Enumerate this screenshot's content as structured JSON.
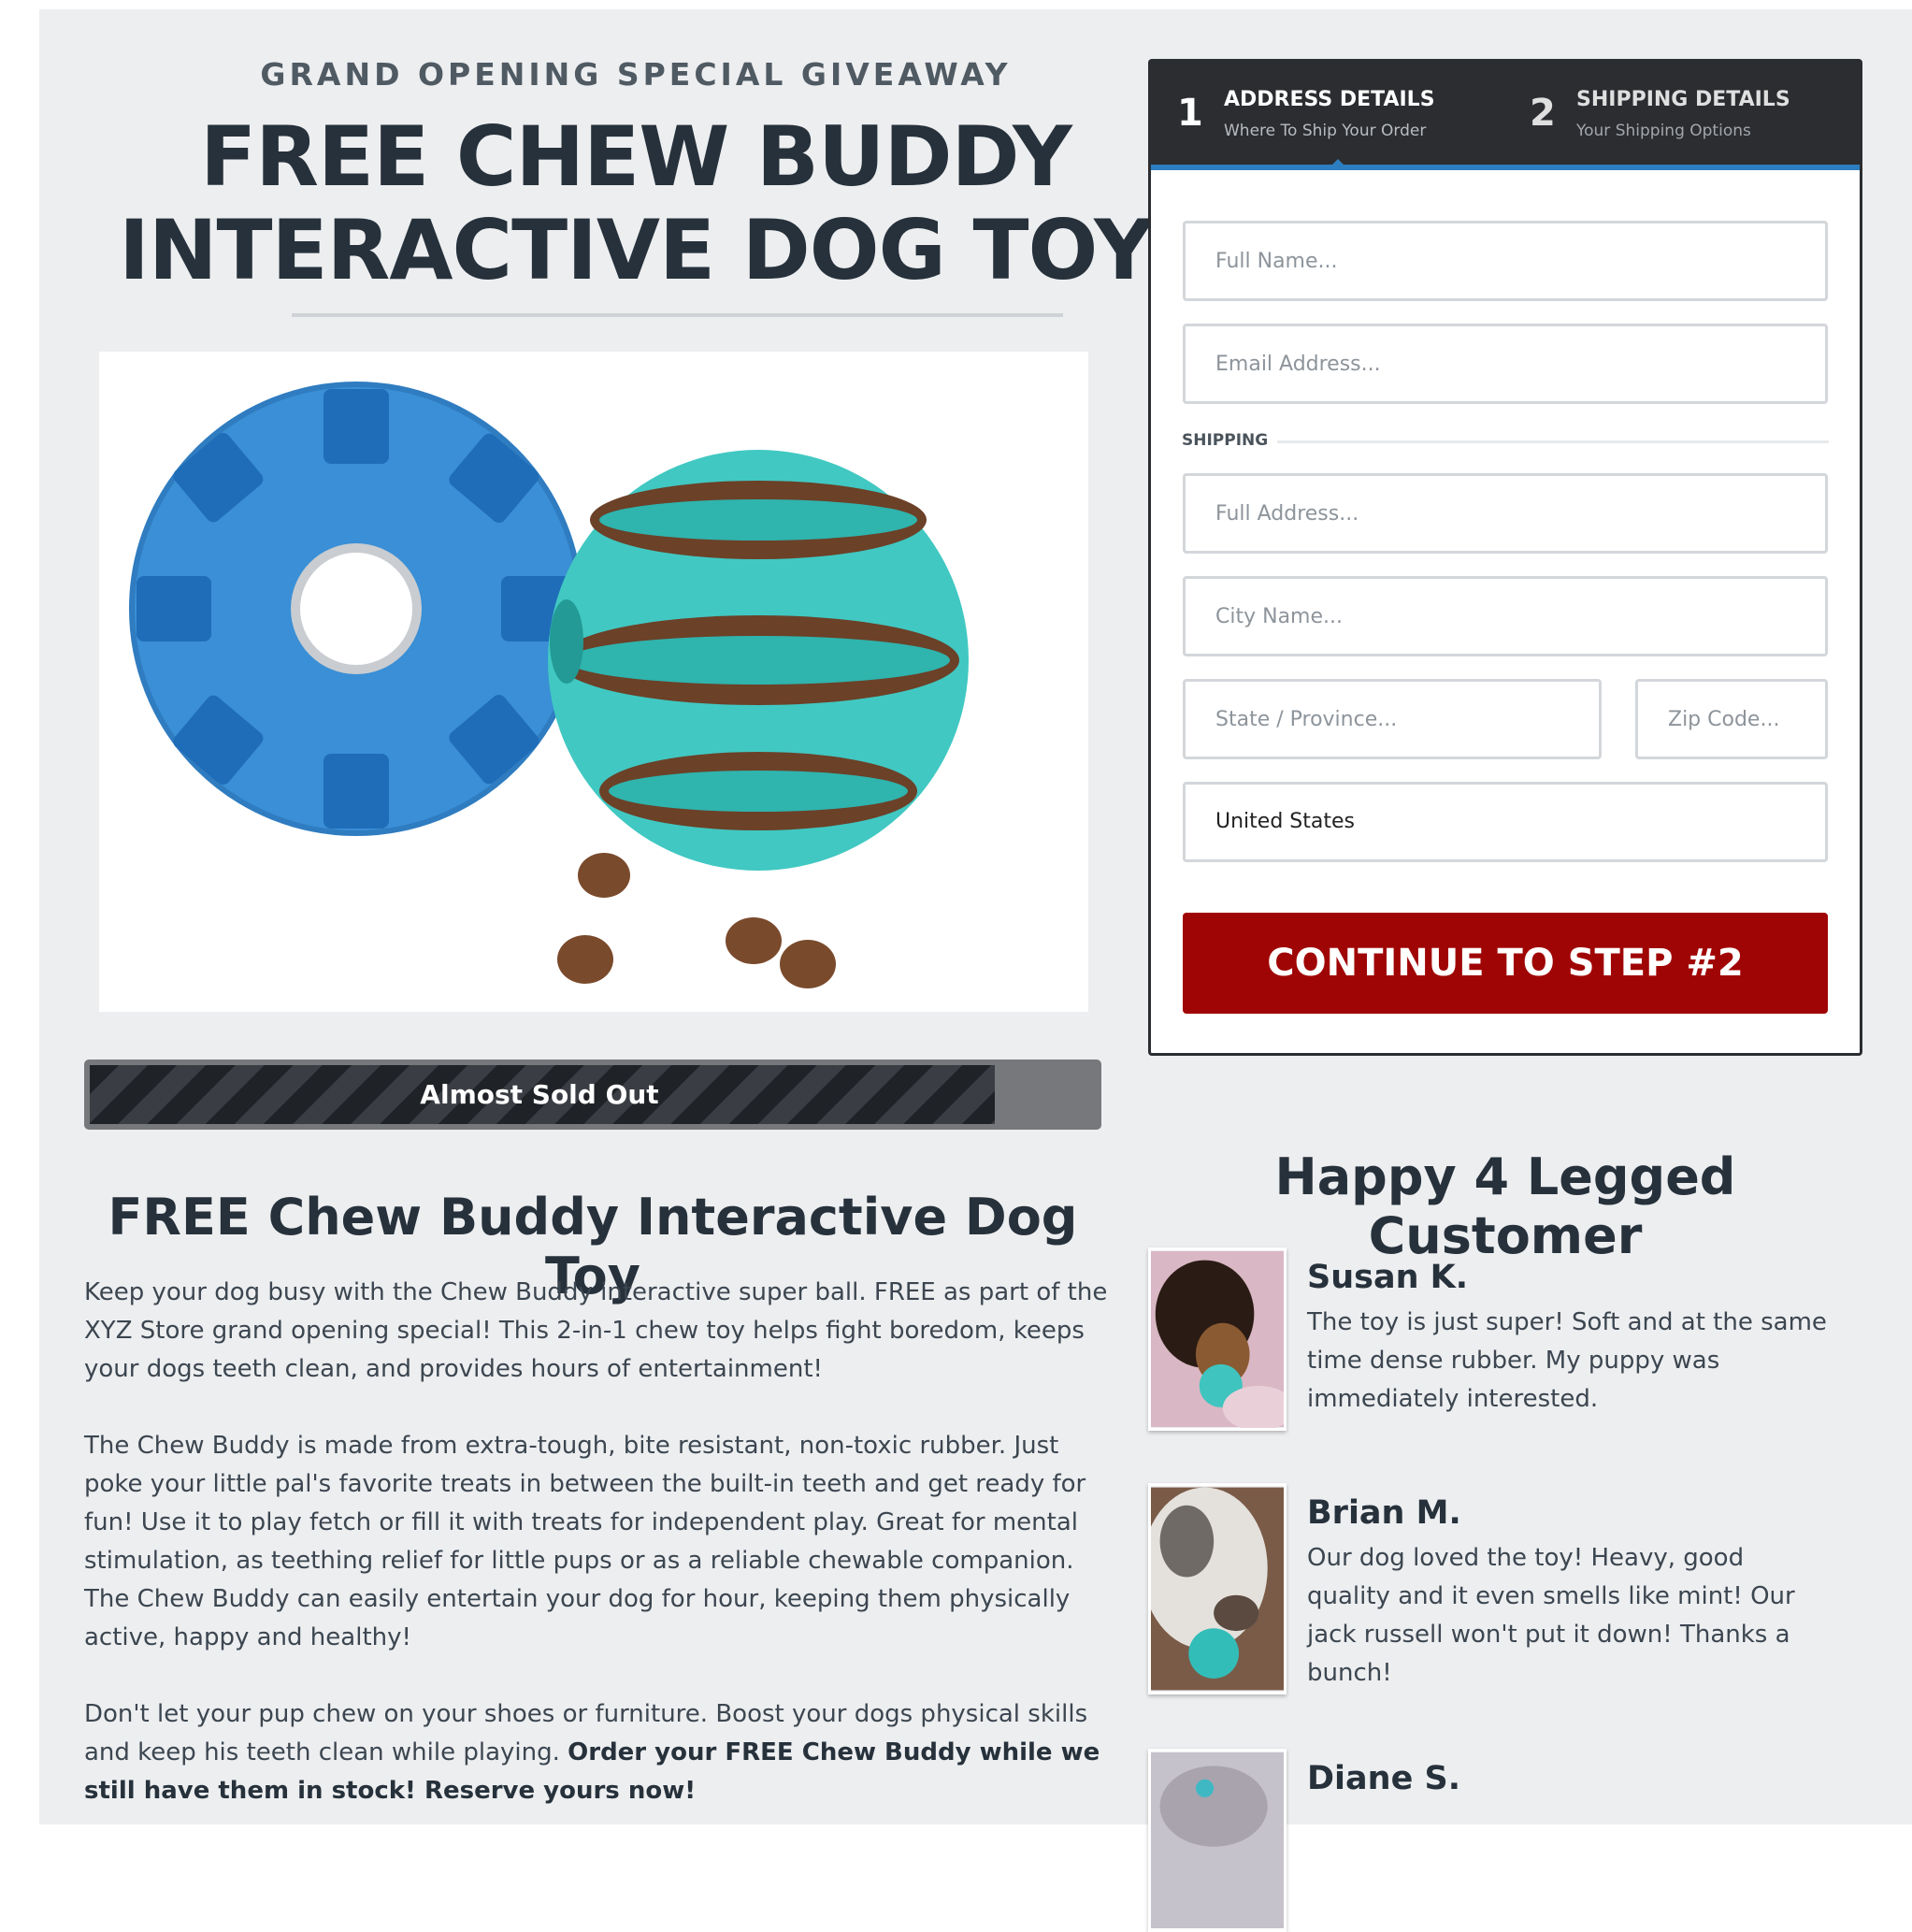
{
  "hero": {
    "eyebrow": "GRAND OPENING SPECIAL GIVEAWAY",
    "headline_line1": "FREE CHEW BUDDY",
    "headline_line2": "INTERACTIVE DOG TOY"
  },
  "stock": {
    "label": "Almost Sold Out",
    "fill_percent": 90
  },
  "product": {
    "title": "FREE Chew Buddy Interactive Dog Toy",
    "paragraph1": "Keep your dog busy with the Chew Buddy interactive super ball. FREE as part of the XYZ Store grand opening special! This 2-in-1 chew toy helps fight boredom, keeps your dogs teeth clean, and provides hours of entertainment!",
    "paragraph2": "The Chew Buddy is made from extra-tough, bite resistant, non-toxic rubber. Just poke your little pal's favorite treats in between the built-in teeth and get ready for fun! Use it to play fetch or fill it with treats for independent play. Great for mental stimulation, as teething relief for little pups or as a reliable chewable companion. The Chew Buddy can easily entertain your dog for hour, keeping them physically active, happy and healthy!",
    "paragraph3_start": "Don't let your pup chew on your shoes or furniture. Boost your dogs physical skills and keep his teeth clean while playing.",
    "paragraph3_bold": "Order your FREE Chew Buddy while we still have them in stock! Reserve yours now!"
  },
  "form": {
    "step1": {
      "number": "1",
      "title": "ADDRESS DETAILS",
      "subtitle": "Where To Ship Your Order"
    },
    "step2": {
      "number": "2",
      "title": "SHIPPING DETAILS",
      "subtitle": "Your Shipping Options"
    },
    "full_name_placeholder": "Full Name...",
    "email_placeholder": "Email Address...",
    "shipping_section_label": "SHIPPING",
    "address_placeholder": "Full Address...",
    "city_placeholder": "City Name...",
    "state_placeholder": "State / Province...",
    "zip_placeholder": "Zip Code...",
    "country_value": "United States",
    "submit_label": "CONTINUE TO STEP #2"
  },
  "reviews": {
    "title": "Happy 4 Legged Customer",
    "items": [
      {
        "name": "Susan K.",
        "text": "The toy is just super! Soft and at the same time dense rubber. My puppy was immediately interested."
      },
      {
        "name": "Brian M.",
        "text": "Our dog loved the toy! Heavy, good quality and it even smells like mint! Our jack russell won't put it down! Thanks a bunch!"
      },
      {
        "name": "Diane S.",
        "text": ""
      }
    ]
  },
  "colors": {
    "page_bg": "#edeef0",
    "heading": "#26313b",
    "cta": "#a00505",
    "step_bar": "#2b2d30",
    "step_accent": "#2d7ec1"
  }
}
